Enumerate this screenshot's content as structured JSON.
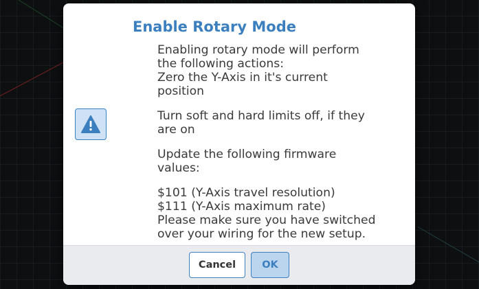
{
  "dialog": {
    "title": "Enable Rotary Mode",
    "icon": "warning-icon",
    "accent_color": "#3c7fbf",
    "message": {
      "intro_line1": "Enabling rotary mode will perform",
      "intro_line2": "the following actions:",
      "zero_line1": "Zero the Y-Axis in it's current",
      "zero_line2": "position",
      "limits_line1": "Turn soft and hard limits off, if they",
      "limits_line2": "are on",
      "firmware_line1": "Update the following firmware",
      "firmware_line2": "values:",
      "setting_101": "$101 (Y-Axis travel resolution)",
      "setting_111": "$111 (Y-Axis maximum rate)",
      "wiring_line1": "Please make sure you have switched",
      "wiring_line2": "over your wiring for the new setup."
    },
    "buttons": {
      "cancel_label": "Cancel",
      "ok_label": "OK"
    }
  }
}
